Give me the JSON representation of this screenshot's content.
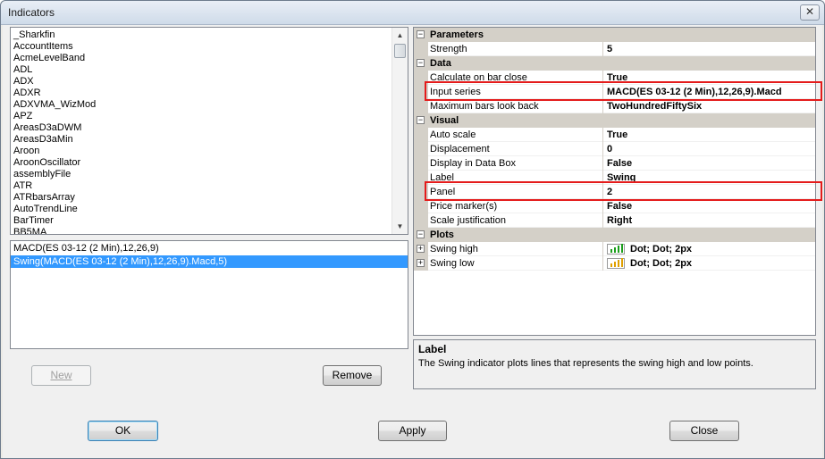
{
  "window": {
    "title": "Indicators",
    "close_glyph": "✕"
  },
  "indicator_list": [
    "_Sharkfin",
    "AccountItems",
    "AcmeLevelBand",
    "ADL",
    "ADX",
    "ADXR",
    "ADXVMA_WizMod",
    "APZ",
    "AreasD3aDWM",
    "AreasD3aMin",
    "Aroon",
    "AroonOscillator",
    "assemblyFile",
    "ATR",
    "ATRbarsArray",
    "AutoTrendLine",
    "BarTimer",
    "BB5MA"
  ],
  "scroll": {
    "up_glyph": "▲",
    "down_glyph": "▼"
  },
  "applied_list": [
    {
      "label": "MACD(ES 03-12 (2 Min),12,26,9)",
      "selected": false
    },
    {
      "label": "Swing(MACD(ES 03-12 (2 Min),12,26,9).Macd,5)",
      "selected": true
    }
  ],
  "buttons": {
    "new_label": "New",
    "remove_label": "Remove",
    "ok_label": "OK",
    "apply_label": "Apply",
    "close_label": "Close"
  },
  "grid": {
    "toggle_open": "⊟",
    "toggle_closed": "⊞",
    "categories": {
      "parameters": "Parameters",
      "data": "Data",
      "visual": "Visual",
      "plots": "Plots"
    },
    "parameters": [
      {
        "name": "Strength",
        "value": "5"
      }
    ],
    "data": [
      {
        "name": "Calculate on bar close",
        "value": "True"
      },
      {
        "name": "Input series",
        "value": "MACD(ES 03-12 (2 Min),12,26,9).Macd"
      },
      {
        "name": "Maximum bars look back",
        "value": "TwoHundredFiftySix"
      }
    ],
    "visual": [
      {
        "name": "Auto scale",
        "value": "True"
      },
      {
        "name": "Displacement",
        "value": "0"
      },
      {
        "name": "Display in Data Box",
        "value": "False"
      },
      {
        "name": "Label",
        "value": "Swing"
      },
      {
        "name": "Panel",
        "value": "2"
      },
      {
        "name": "Price marker(s)",
        "value": "False"
      },
      {
        "name": "Scale justification",
        "value": "Right"
      }
    ],
    "plots": [
      {
        "name": "Swing high",
        "value": "Dot; Dot; 2px",
        "color": "#1a9e1a"
      },
      {
        "name": "Swing low",
        "value": "Dot; Dot; 2px",
        "color": "#e0a000"
      }
    ]
  },
  "description": {
    "title": "Label",
    "text": "The Swing indicator plots lines that represents the swing high and low points."
  },
  "colors": {
    "highlight": "#e41b1b",
    "selection": "#3399ff"
  }
}
